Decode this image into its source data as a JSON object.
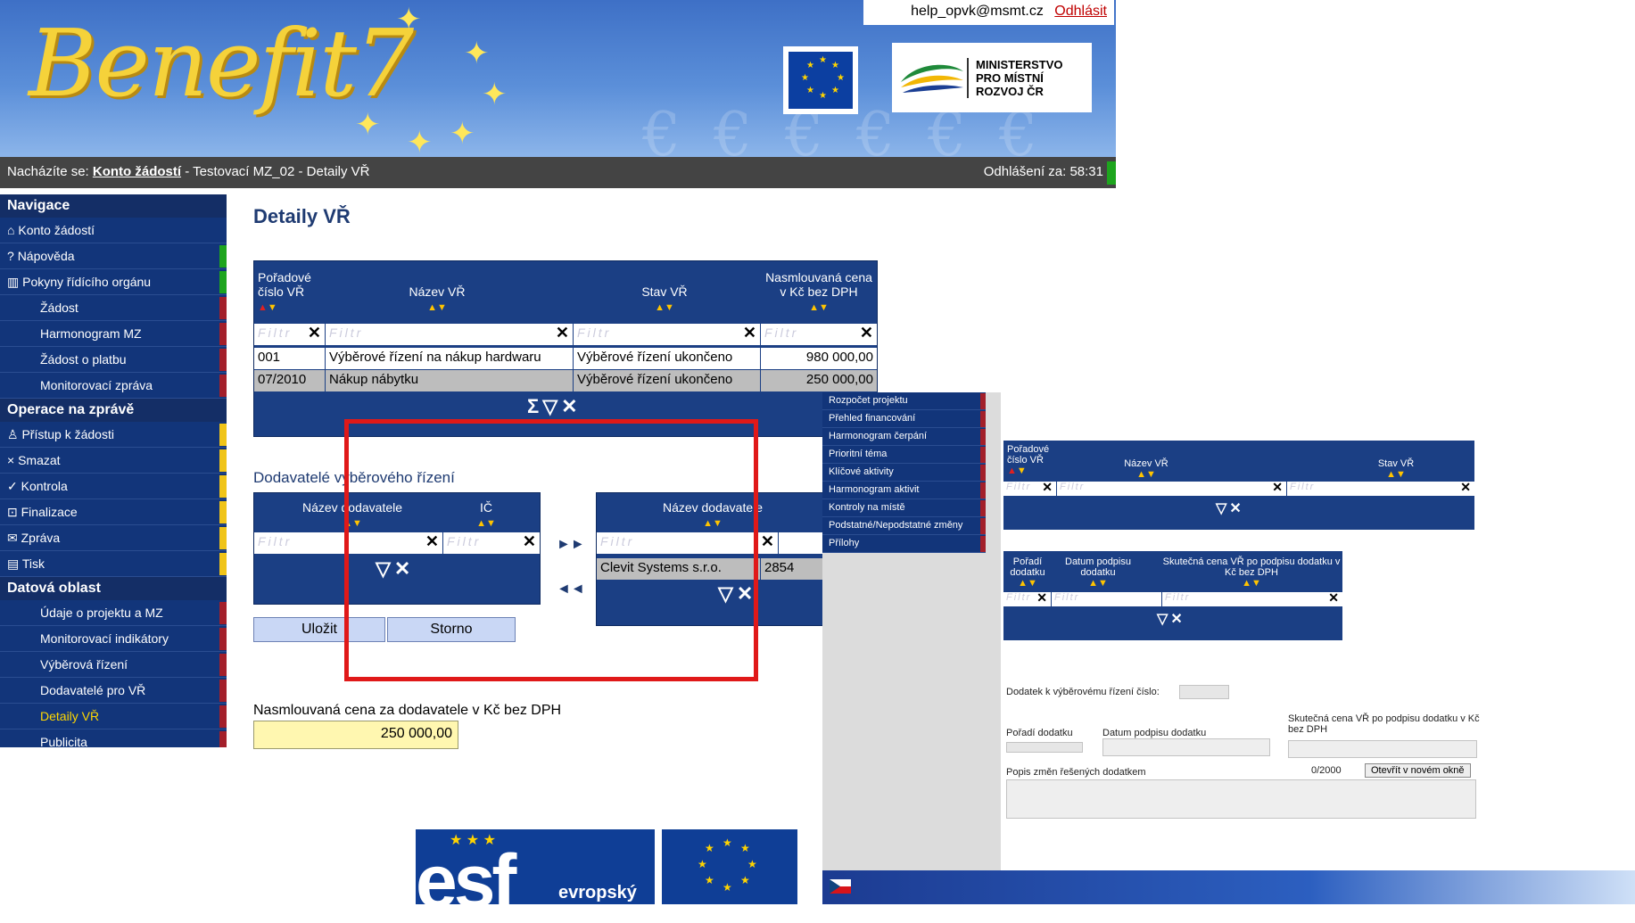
{
  "header": {
    "app_name": "Benefit7",
    "user_email": "help_opvk@msmt.cz",
    "logout_label": "Odhlásit",
    "ministry_line1": "MINISTERSTVO",
    "ministry_line2": "PRO MÍSTNÍ",
    "ministry_line3": "ROZVOJ ČR"
  },
  "breadcrumb": {
    "prefix": "Nacházíte se:",
    "link": "Konto žádostí",
    "rest": "- Testovací MZ_02 - Detaily VŘ",
    "timer": "Odhlášení za: 58:31"
  },
  "sidebar": {
    "sec_nav": "Navigace",
    "nav": [
      "Konto žádostí",
      "Nápověda",
      "Pokyny řídícího orgánu",
      "Žádost",
      "Harmonogram MZ",
      "Žádost o platbu",
      "Monitorovací zpráva"
    ],
    "sec_ops": "Operace na zprávě",
    "ops": [
      "Přístup k žádosti",
      "Smazat",
      "Kontrola",
      "Finalizace",
      "Zpráva",
      "Tisk"
    ],
    "sec_data": "Datová oblast",
    "data": [
      "Údaje o projektu a MZ",
      "Monitorovací indikátory",
      "Výběrová řízení",
      "Dodavatelé pro VŘ",
      "Detaily VŘ",
      "Publicita"
    ]
  },
  "main": {
    "title": "Detaily VŘ",
    "grid1": {
      "headers": [
        "Pořadové číslo VŘ",
        "Název VŘ",
        "Stav VŘ",
        "Nasmlouvaná cena v Kč bez DPH"
      ],
      "filter": "Filtr",
      "rows": [
        [
          "001",
          "Výběrové řízení na nákup hardwaru",
          "Výběrové řízení ukončeno",
          "980 000,00"
        ],
        [
          "07/2010",
          "Nákup nábytku",
          "Výběrové řízení ukončeno",
          "250 000,00"
        ]
      ]
    },
    "suppliers_title": "Dodavatelé výběrového řízení",
    "left_grid": {
      "headers": [
        "Název dodavatele",
        "IČ"
      ],
      "filter": "Filtr"
    },
    "right_grid": {
      "headers": [
        "Název dodavatele"
      ],
      "filter": "Filtr",
      "rows": [
        [
          "Clevit Systems s.r.o.",
          "2854"
        ]
      ]
    },
    "save_label": "Uložit",
    "cancel_label": "Storno",
    "contract_label": "Nasmlouvaná cena za dodavatele v Kč bez DPH",
    "contract_value": "250 000,00"
  },
  "overlay": {
    "menu": [
      "Rozpočet projektu",
      "Přehled financování",
      "Harmonogram čerpání",
      "Prioritní téma",
      "Klíčové aktivity",
      "Harmonogram aktivit",
      "Kontroly na místě",
      "Podstatné/Nepodstatné změny",
      "Přílohy"
    ],
    "grid_a_headers": [
      "Pořadové číslo VŘ",
      "Název VŘ",
      "Stav VŘ"
    ],
    "grid_b_headers": [
      "Pořadí dodatku",
      "Datum podpisu dodatku",
      "Skutečná cena VŘ po podpisu dodatku v Kč bez DPH"
    ],
    "filter": "Filtr",
    "amendment_label": "Dodatek k výběrovému řízení číslo:",
    "order_label": "Pořadí dodatku",
    "date_label": "Datum podpisu dodatku",
    "price_label": "Skutečná cena VŘ po podpisu dodatku v Kč bez DPH",
    "desc_label": "Popis změn řešených dodatkem",
    "counter": "0/2000",
    "open_label": "Otevřít v novém okně"
  },
  "footer": {
    "esf_letters": "esf",
    "esf_word": "evropský"
  },
  "colors": {
    "nav_blue": "#12357a",
    "accent_red": "#e01919",
    "marker_yellow": "#f0c419",
    "marker_green": "#1ea51e",
    "marker_red": "#a31f2a"
  }
}
